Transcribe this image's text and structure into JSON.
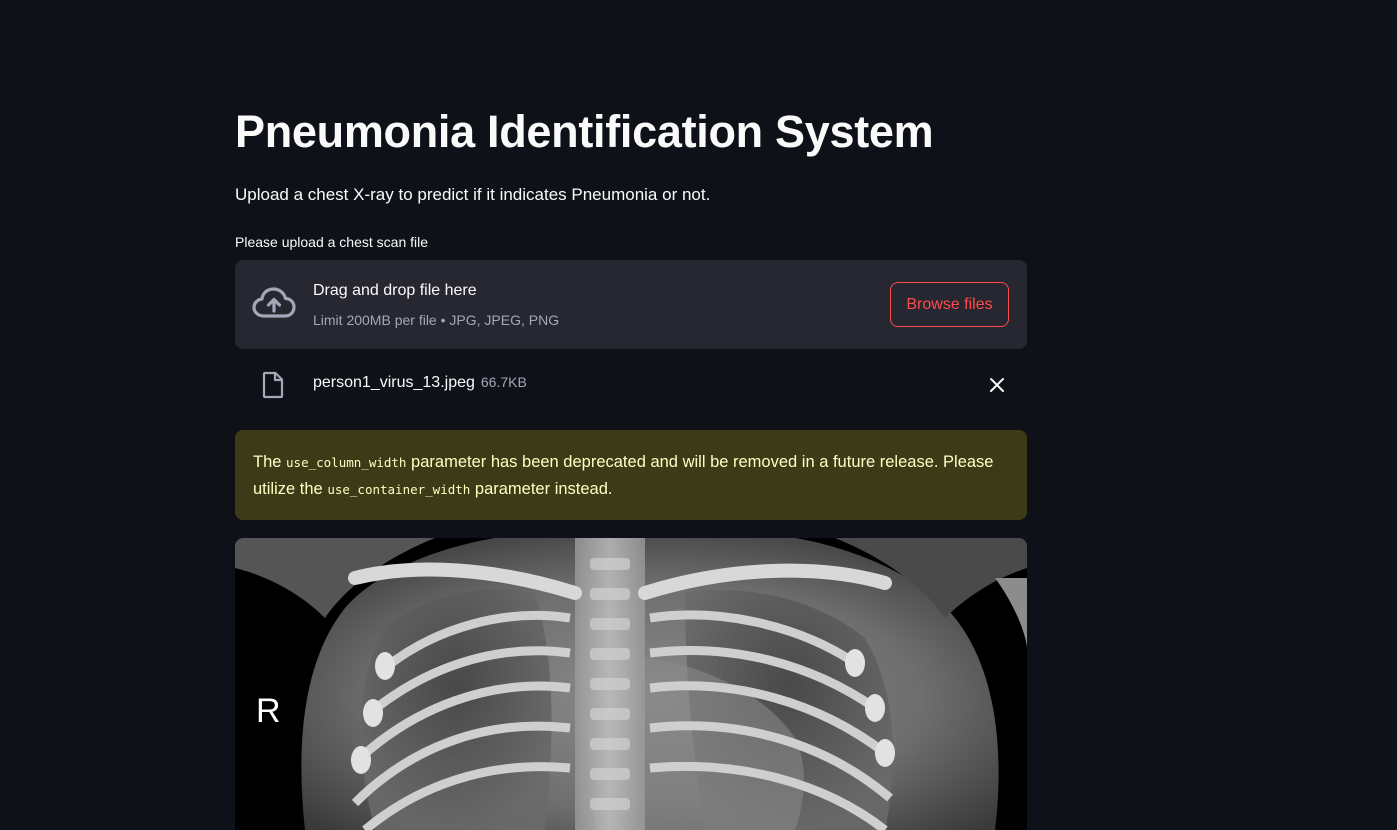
{
  "page": {
    "title": "Pneumonia Identification System",
    "subtitle": "Upload a chest X-ray to predict if it indicates Pneumonia or not."
  },
  "uploader": {
    "label": "Please upload a chest scan file",
    "drop_text": "Drag and drop file here",
    "limit_text": "Limit 200MB per file • JPG, JPEG, PNG",
    "browse_label": "Browse files",
    "upload_icon": "cloud-upload-icon"
  },
  "uploaded_file": {
    "name": "person1_virus_13.jpeg",
    "size": "66.7KB",
    "file_icon": "file-icon",
    "remove_icon": "close-icon"
  },
  "warning": {
    "prefix": "The",
    "code_1": "use_column_width",
    "middle": "parameter has been deprecated and will be removed in a future release. Please utilize the",
    "code_2": "use_container_width",
    "suffix": "parameter instead."
  },
  "image": {
    "marker_letter": "R"
  },
  "colors": {
    "background": "#0e1117",
    "dropzone": "#262730",
    "accent": "#ff4b4b",
    "warning_bg": "#3d3a18",
    "warning_text": "#ffffc2",
    "muted_text": "#a3a8b8"
  }
}
